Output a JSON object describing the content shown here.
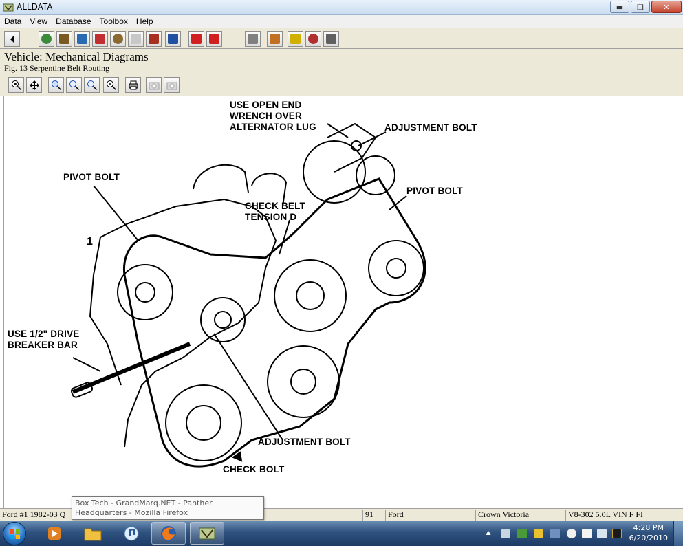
{
  "window": {
    "title": "ALLDATA"
  },
  "menu": {
    "items": [
      "Data",
      "View",
      "Database",
      "Toolbox",
      "Help"
    ]
  },
  "header": {
    "title": "Vehicle:  Mechanical Diagrams",
    "figure": "Fig. 13 Serpentine Belt Routing"
  },
  "diagram": {
    "labels": {
      "open_end": "USE OPEN END\nWRENCH OVER\nALTERNATOR LUG",
      "adjustment_bolt_top": "ADJUSTMENT BOLT",
      "pivot_bolt_left": "PIVOT BOLT",
      "pivot_bolt_right": "PIVOT BOLT",
      "check_belt": "CHECK BELT\nTENSION D",
      "drive_bar": "USE 1/2\" DRIVE\nBREAKER BAR",
      "adjustment_bolt_bottom": "ADJUSTMENT BOLT",
      "check_bolt": "CHECK BOLT",
      "numeral": "1"
    }
  },
  "tooltip": {
    "text": "Box Tech - GrandMarq.NET - Panther Headquarters - Mozilla Firefox"
  },
  "status": {
    "cell1": "Ford #1 1982-03 Q",
    "cell2": "91",
    "cell3": "Ford",
    "cell4": "Crown Victoria",
    "cell5": "V8-302 5.0L VIN F FI"
  },
  "taskbar": {
    "time": "4:28 PM",
    "date": "6/20/2010"
  }
}
